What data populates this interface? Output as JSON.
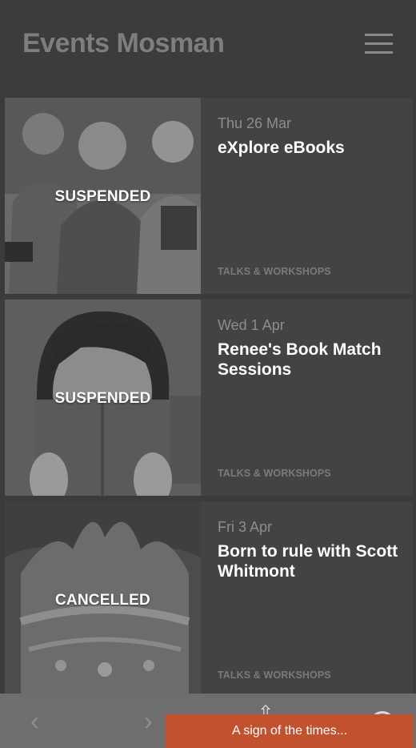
{
  "header": {
    "title": "Events Mosman",
    "menu_icon": "hamburger-icon"
  },
  "events": [
    {
      "status": "SUSPENDED",
      "date": "Thu 26 Mar",
      "title": "eXplore eBooks",
      "category": "TALKS & WORKSHOPS"
    },
    {
      "status": "SUSPENDED",
      "date": "Wed 1 Apr",
      "title": "Renee's Book Match Sessions",
      "category": "TALKS & WORKSHOPS"
    },
    {
      "status": "CANCELLED",
      "date": "Fri 3 Apr",
      "title": "Born to rule with Scott Whitmont",
      "category": "TALKS & WORKSHOPS"
    }
  ],
  "bottom_bar": {
    "back_label": "‹",
    "forward_label": "›",
    "icons": [
      "back-icon",
      "forward-icon",
      "share-icon",
      "help-icon"
    ]
  },
  "toast": {
    "text": "A sign of the times..."
  },
  "colors": {
    "background": "#3b3b3b",
    "card": "#434343",
    "toast": "#c2512f",
    "toolbar": "#6e6e6e"
  }
}
